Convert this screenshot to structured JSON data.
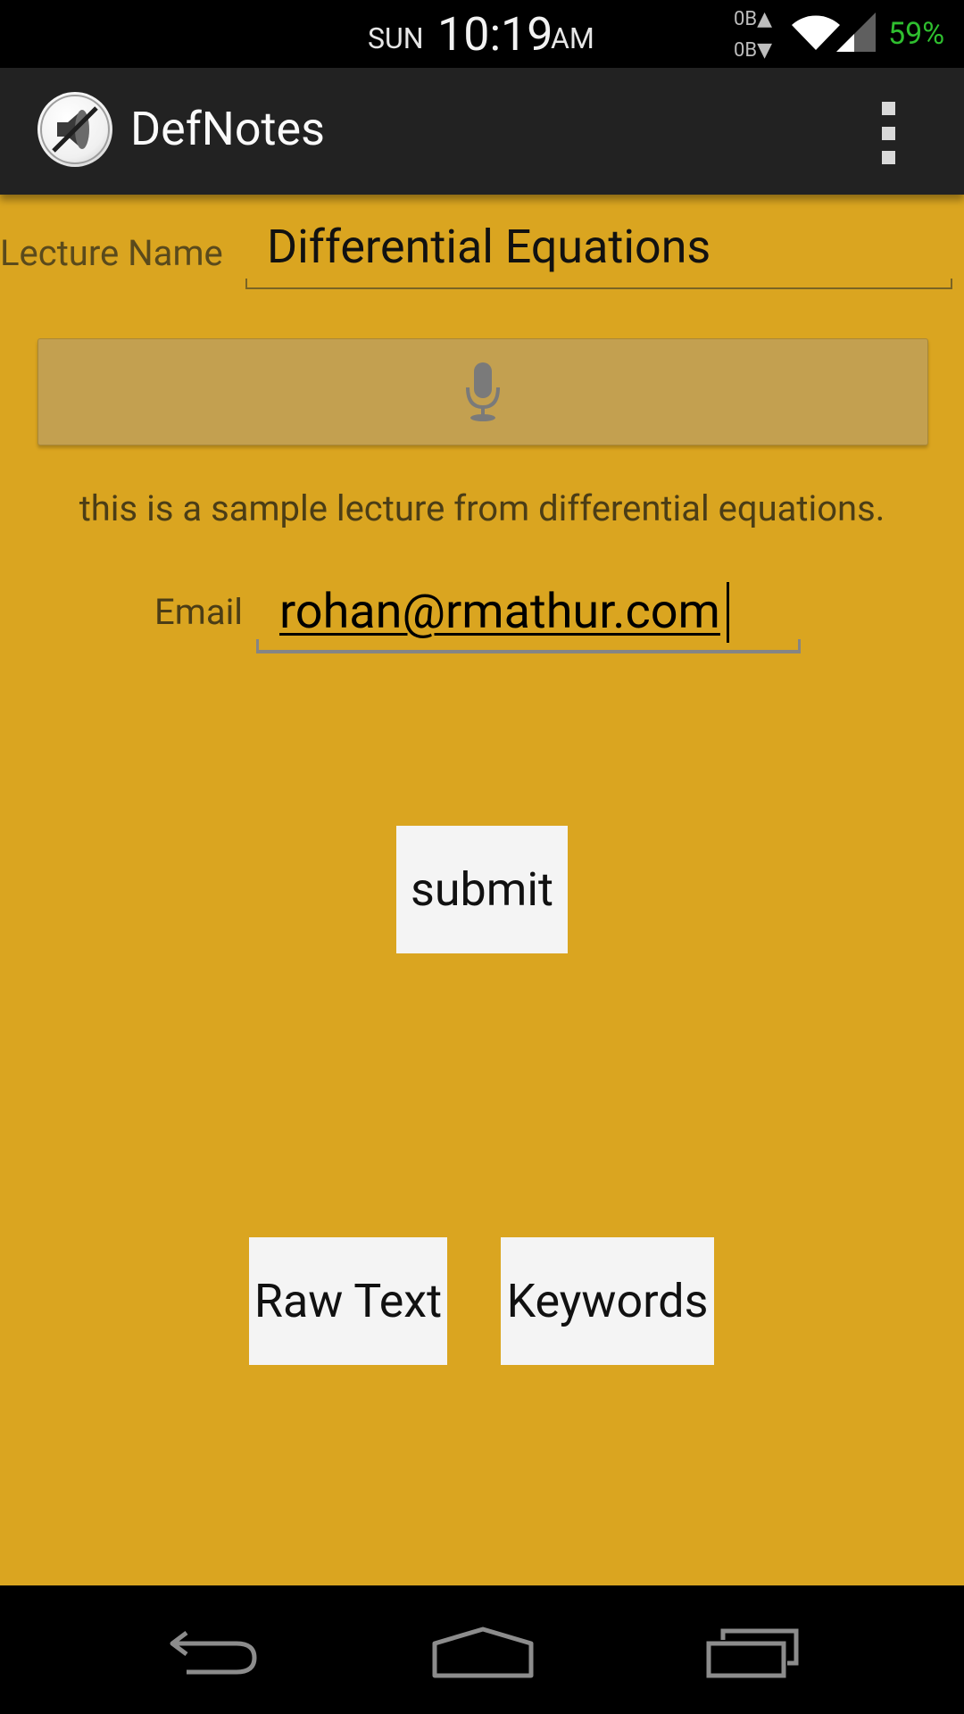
{
  "status_bar": {
    "day": "SUN",
    "time": "10:19",
    "ampm": "AM",
    "data_up": "0B",
    "data_down": "0B",
    "battery": "59%",
    "icons": [
      "data-activity-icon",
      "wifi-icon",
      "cell-signal-icon"
    ]
  },
  "action_bar": {
    "app_title": "DefNotes",
    "app_icon": "muted-speaker-icon",
    "overflow_icon": "overflow-menu-icon"
  },
  "form": {
    "lecture_label": "Lecture Name",
    "lecture_value": "Differential Equations",
    "mic_icon": "microphone-icon",
    "transcript": "this is a sample lecture from differential equations.",
    "email_label": "Email",
    "email_value": "rohan@rmathur.com",
    "submit_label": "submit",
    "raw_text_label": "Raw Text",
    "keywords_label": "Keywords"
  },
  "nav_bar": {
    "icons": [
      "back-icon",
      "home-icon",
      "recent-apps-icon"
    ]
  },
  "colors": {
    "background": "#daa520",
    "action_bar": "#222222",
    "mic_button": "#c3a050",
    "button": "#f4f4f4",
    "battery": "#2fbf2f"
  }
}
